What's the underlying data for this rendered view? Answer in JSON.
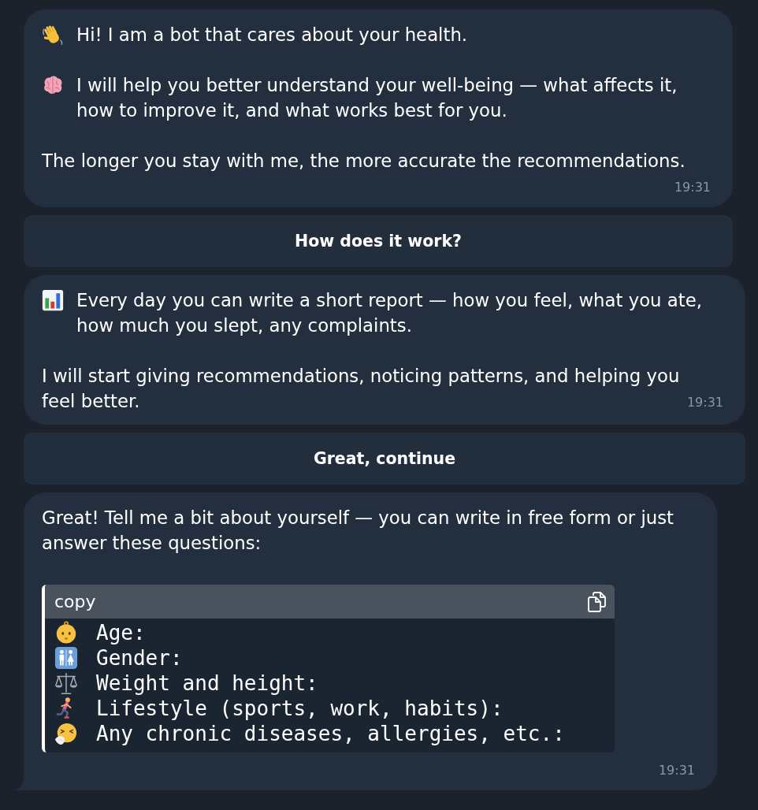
{
  "messages": [
    {
      "tail": false,
      "paragraphs": [
        "Hi! I am a bot that cares about your health.",
        "I will help you better understand your well-being — what affects it, how to improve it, and what works best for you.",
        "The longer you stay with me, the more accurate the recommendations."
      ],
      "time": "19:31",
      "buttons": [
        "How does it work?"
      ]
    },
    {
      "tail": false,
      "paragraphs": [
        "Every day you can write a short report — how you feel, what you ate, how much you slept, any complaints.",
        "I will start giving recommendations, noticing patterns, and helping you feel better."
      ],
      "time": "19:31",
      "buttons": [
        "Great, continue"
      ]
    },
    {
      "tail": true,
      "paragraphs": [
        "Great! Tell me a bit about yourself — you can write in free form or just answer these questions:"
      ],
      "code_block": {
        "header": "copy",
        "lines": [
          "Age:",
          "Gender:",
          "Weight and height:",
          "Lifestyle (sports, work, habits):",
          "Any chronic diseases, allergies, etc.:"
        ]
      },
      "time": "19:31"
    }
  ]
}
